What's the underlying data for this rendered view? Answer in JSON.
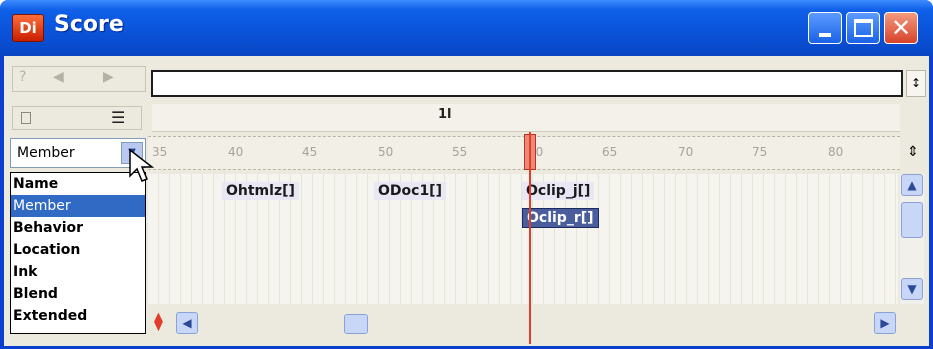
{
  "window": {
    "icon_text": "Di",
    "title": "Score"
  },
  "top_nav": {
    "icons": [
      "question-icon",
      "prev-icon",
      "next-icon"
    ]
  },
  "ruler": {
    "frame_marker": "1l",
    "ticks": [
      "35",
      "40",
      "45",
      "50",
      "55",
      "60",
      "65",
      "70",
      "75",
      "80"
    ]
  },
  "channel_selector": {
    "value": "Member",
    "options": [
      "Name",
      "Member",
      "Behavior",
      "Location",
      "Ink",
      "Blend",
      "Extended"
    ],
    "selected_index": 1
  },
  "sprites": [
    {
      "label": "Ohtmlz[]",
      "selected": false
    },
    {
      "label": "ODoc1[]",
      "selected": false
    },
    {
      "label": "Oclip_j[]",
      "selected": false
    },
    {
      "label": "Oclip_r[]",
      "selected": true
    }
  ]
}
